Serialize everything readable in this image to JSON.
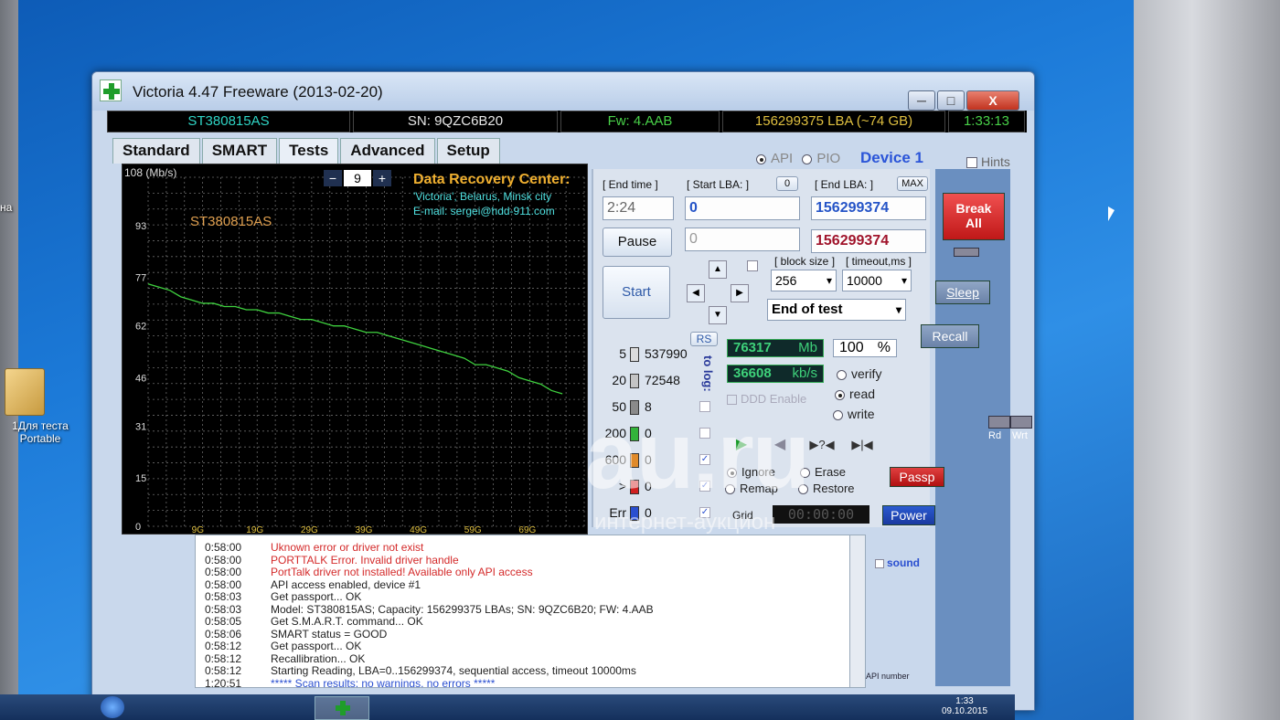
{
  "desktop": {
    "left_text": "на",
    "icon_label_1": "1Для теста",
    "icon_label_2": "Portable"
  },
  "window": {
    "title": "Victoria 4.47  Freeware (2013-02-20)",
    "minimize": "─",
    "maximize": "□",
    "close": "X"
  },
  "infobar": {
    "model": "ST380815AS",
    "serial": "SN: 9QZC6B20",
    "firmware": "Fw: 4.AAB",
    "capacity": "156299375 LBA (~74 GB)",
    "clock": "1:33:13"
  },
  "tabs": [
    {
      "label": "Standard"
    },
    {
      "label": "SMART"
    },
    {
      "label": "Tests"
    },
    {
      "label": "Advanced"
    },
    {
      "label": "Setup"
    }
  ],
  "mode": {
    "api": "API",
    "pio": "PIO",
    "device": "Device 1",
    "hints": "Hints"
  },
  "graph": {
    "ylabel": "108 (Mb/s)",
    "yticks": [
      "93",
      "77",
      "62",
      "46",
      "31",
      "15",
      "0"
    ],
    "xticks": [
      "9G",
      "19G",
      "29G",
      "39G",
      "49G",
      "59G",
      "69G"
    ],
    "spin_minus": "−",
    "spin_value": "9",
    "spin_plus": "+",
    "model_label": "ST380815AS",
    "drc_title": "Data Recovery Center:",
    "drc_line1": "'Victoria', Belarus, Minsk city",
    "drc_line2": "E-mail: sergei@hdd-911.com"
  },
  "chart_data": {
    "type": "line",
    "ylabel": "(Mb/s)",
    "ylim": [
      0,
      108
    ],
    "x_ticks": [
      "9G",
      "19G",
      "29G",
      "39G",
      "49G",
      "59G",
      "69G"
    ],
    "series": [
      {
        "x": [
          0,
          2,
          4,
          6,
          8,
          10,
          12,
          14,
          16,
          18,
          20,
          22,
          24,
          26,
          28,
          30,
          32,
          34,
          36,
          38,
          40,
          42,
          44,
          46,
          48,
          50,
          52,
          54,
          56,
          58,
          60,
          62,
          64,
          66,
          68,
          70,
          72,
          74,
          76
        ],
        "values": [
          75,
          74,
          73,
          71,
          70,
          69,
          69,
          68,
          68,
          67,
          67,
          66,
          66,
          65,
          64,
          64,
          63,
          62,
          62,
          61,
          60,
          60,
          59,
          58,
          57,
          56,
          55,
          54,
          53,
          52,
          50,
          50,
          49,
          48,
          46,
          45,
          44,
          42,
          41
        ]
      }
    ]
  },
  "controls": {
    "end_time_label": "[ End time ]",
    "start_lba_label": "[ Start LBA: ]",
    "start_lba_zero": "0",
    "end_lba_label": "[ End LBA: ]",
    "max_label": "MAX",
    "end_time_value": "2:24",
    "start_lba_value": "0",
    "end_lba_value": "156299374",
    "pause": "Pause",
    "current_lba": "0",
    "current_end": "156299374",
    "start": "Start",
    "block_size_label": "[ block size ]",
    "timeout_label": "[ timeout,ms ]",
    "block_size": "256",
    "timeout": "10000",
    "end_action": "End of test",
    "rs": "RS",
    "to_log": "to log:"
  },
  "stats": [
    {
      "ms": "5",
      "count": "537990",
      "color": "#dcdcdc"
    },
    {
      "ms": "20",
      "count": "72548",
      "color": "#c4c4c4"
    },
    {
      "ms": "50",
      "count": "8",
      "color": "#8a8a8a"
    },
    {
      "ms": "200",
      "count": "0",
      "color": "#33b33a"
    },
    {
      "ms": "600",
      "count": "0",
      "color": "#e08a2a"
    },
    {
      "ms": ">",
      "count": "0",
      "color": "#d02020"
    },
    {
      "ms": "Err",
      "count": "0",
      "color": "#2a4fd0"
    }
  ],
  "progress": {
    "mb": "76317",
    "mb_unit": "Mb",
    "percent": "100",
    "percent_unit": "%",
    "speed": "36608",
    "speed_unit": "kb/s",
    "ddd": "DDD Enable",
    "verify": "verify",
    "read": "read",
    "write": "write",
    "ignore": "Ignore",
    "erase": "Erase",
    "remap": "Remap",
    "restore": "Restore",
    "grid": "Grid",
    "grid_timer": "00:00:00"
  },
  "side": {
    "break_all_1": "Break",
    "break_all_2": "All",
    "sleep": "Sleep",
    "recall": "Recall",
    "rd": "Rd",
    "wrt": "Wrt",
    "passp": "Passp",
    "power": "Power",
    "sound": "sound",
    "api_number": "API number"
  },
  "log": [
    {
      "time": "0:58:00",
      "text": "Uknown error or driver not exist",
      "color": "#d42a2a"
    },
    {
      "time": "0:58:00",
      "text": "PORTTALK Error. Invalid driver handle",
      "color": "#d42a2a"
    },
    {
      "time": "0:58:00",
      "text": "PortTalk driver not installed! Available only API access",
      "color": "#d42a2a"
    },
    {
      "time": "0:58:00",
      "text": "API access enabled, device #1",
      "color": "#222222"
    },
    {
      "time": "0:58:03",
      "text": "Get passport... OK",
      "color": "#222222"
    },
    {
      "time": "0:58:03",
      "text": "Model: ST380815AS; Capacity: 156299375 LBAs; SN: 9QZC6B20; FW: 4.AAB",
      "color": "#222222"
    },
    {
      "time": "0:58:05",
      "text": "Get S.M.A.R.T. command... OK",
      "color": "#222222"
    },
    {
      "time": "0:58:06",
      "text": "SMART status = GOOD",
      "color": "#222222"
    },
    {
      "time": "0:58:12",
      "text": "Get passport... OK",
      "color": "#222222"
    },
    {
      "time": "0:58:12",
      "text": "Recallibration... OK",
      "color": "#222222"
    },
    {
      "time": "0:58:12",
      "text": "Starting Reading, LBA=0..156299374, sequential access, timeout 10000ms",
      "color": "#222222"
    },
    {
      "time": "1:20:51",
      "text": "***** Scan results: no warnings, no errors *****",
      "color": "#2a4fd0"
    }
  ],
  "taskbar": {
    "time": "1:33",
    "date": "09.10.2015"
  },
  "watermark": {
    "brand": "au.ru",
    "tagline": "интернет-аукцион"
  }
}
